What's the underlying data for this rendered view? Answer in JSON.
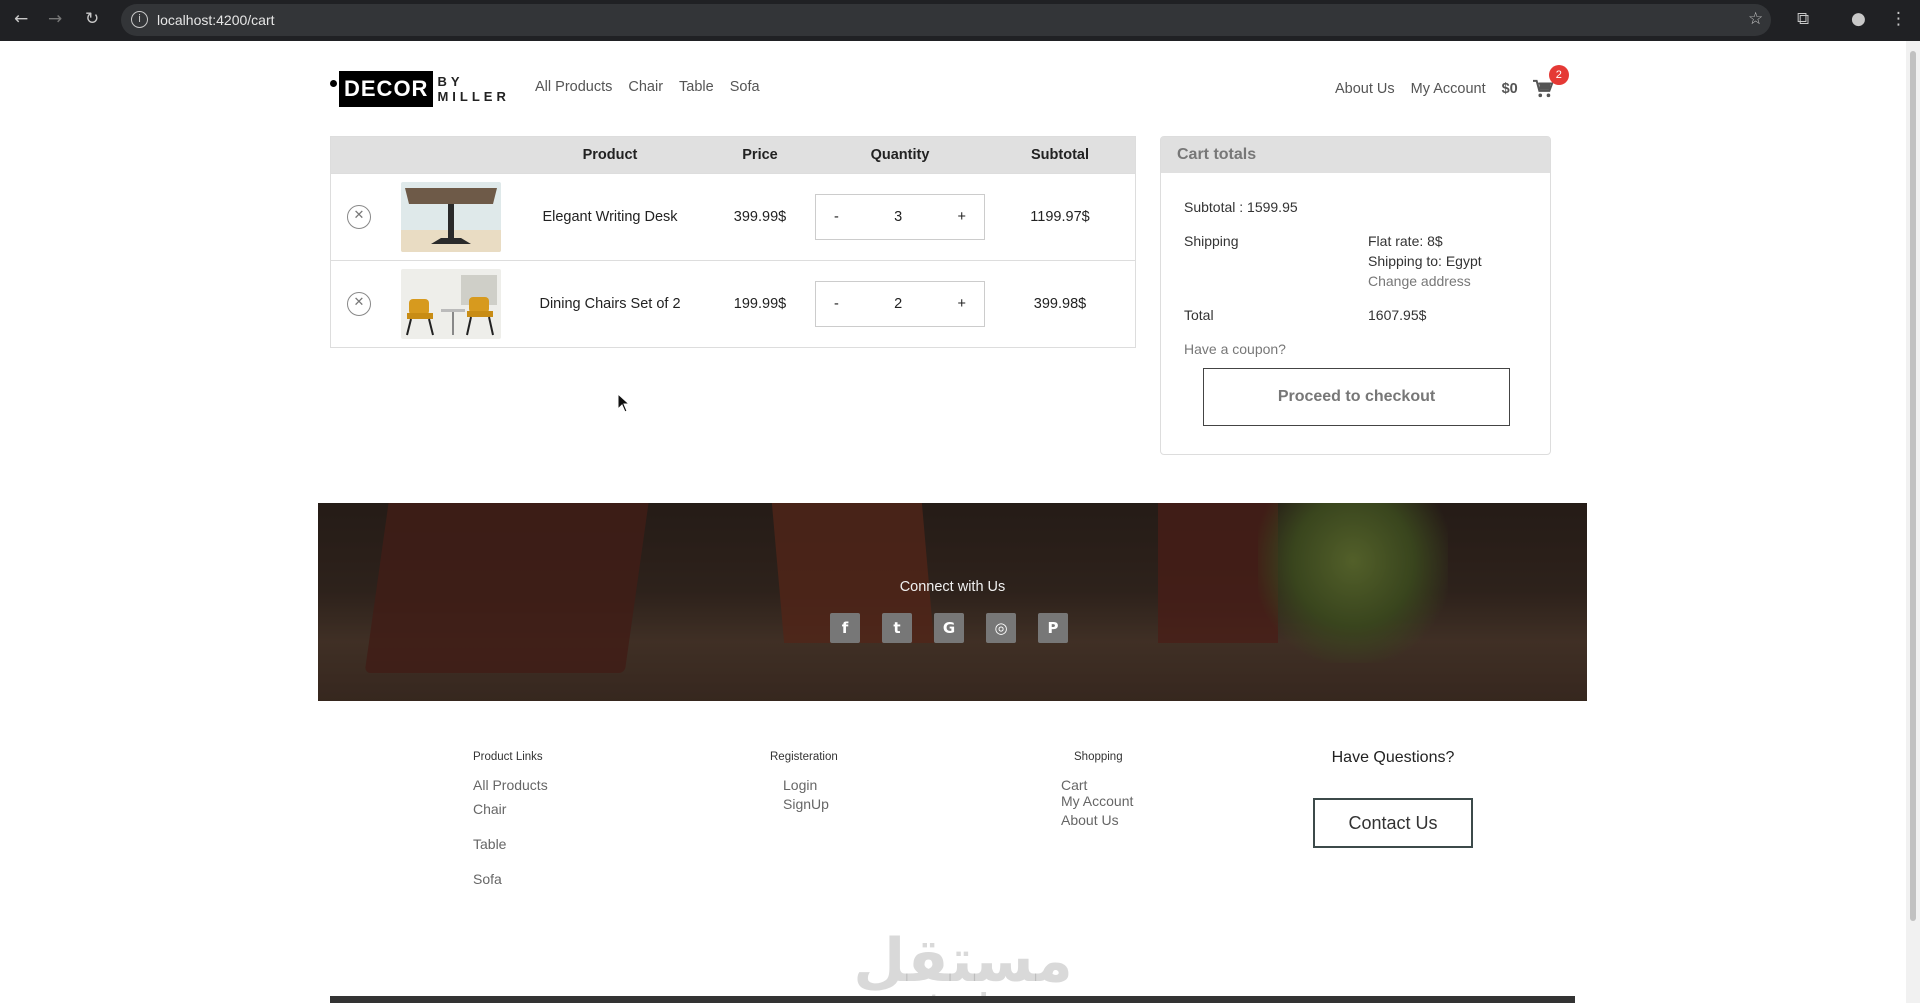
{
  "browser": {
    "url": "localhost:4200/cart"
  },
  "header": {
    "logo": {
      "main": "DECOR",
      "top": "BY",
      "bottom": "MILLER"
    },
    "nav": [
      "All Products",
      "Chair",
      "Table",
      "Sofa"
    ],
    "about": "About Us",
    "account": "My Account",
    "price": "$0",
    "cart_count": "2"
  },
  "cart": {
    "columns": {
      "product": "Product",
      "price": "Price",
      "quantity": "Quantity",
      "subtotal": "Subtotal"
    },
    "minus": "-",
    "plus": "+",
    "items": [
      {
        "name": "Elegant Writing Desk",
        "price": "399.99$",
        "qty": "3",
        "subtotal": "1199.97$"
      },
      {
        "name": "Dining Chairs Set of 2",
        "price": "199.99$",
        "qty": "2",
        "subtotal": "399.98$"
      }
    ]
  },
  "totals": {
    "title": "Cart totals",
    "subtotal": "Subtotal : 1599.95",
    "shipping_label": "Shipping",
    "flat_rate": "Flat rate: 8$",
    "shipping_to": "Shipping to: Egypt",
    "change_address": "Change address",
    "total_label": "Total",
    "total_value": "1607.95$",
    "coupon": "Have a coupon?",
    "checkout": "Proceed to checkout"
  },
  "banner": {
    "connect": "Connect with Us",
    "icons": [
      "facebook-icon",
      "twitter-icon",
      "google-icon",
      "instagram-icon",
      "pinterest-icon"
    ]
  },
  "footer": {
    "product_links": {
      "title": "Product Links",
      "items": [
        "All Products",
        "Chair",
        "Table",
        "Sofa"
      ]
    },
    "registration": {
      "title": "Registeration",
      "items": [
        "Login",
        "SignUp"
      ]
    },
    "shopping": {
      "title": "Shopping",
      "items": [
        "Cart",
        "My Account",
        "About Us"
      ]
    },
    "questions": "Have Questions?",
    "contact": "Contact Us"
  },
  "watermark": {
    "arabic": "مستقل",
    "latin": "mostaql.com"
  }
}
